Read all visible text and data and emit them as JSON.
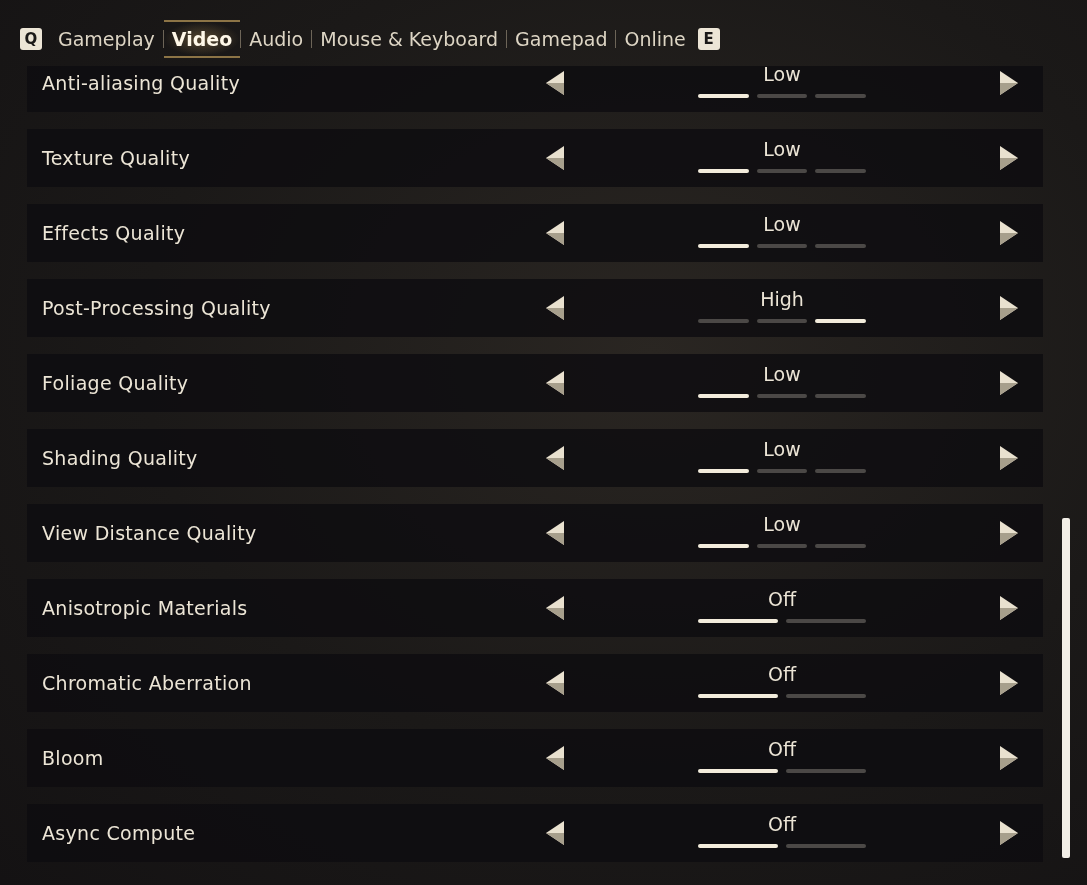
{
  "tabs": {
    "prev_key": "Q",
    "next_key": "E",
    "items": [
      {
        "label": "Gameplay",
        "selected": false
      },
      {
        "label": "Video",
        "selected": true
      },
      {
        "label": "Audio",
        "selected": false
      },
      {
        "label": "Mouse & Keyboard",
        "selected": false
      },
      {
        "label": "Gamepad",
        "selected": false
      },
      {
        "label": "Online",
        "selected": false
      }
    ]
  },
  "settings": [
    {
      "label": "Anti-aliasing Quality",
      "value": "Low",
      "segments": [
        {
          "selected": true
        },
        {
          "selected": false
        },
        {
          "selected": false
        }
      ]
    },
    {
      "label": "Texture Quality",
      "value": "Low",
      "segments": [
        {
          "selected": true
        },
        {
          "selected": false
        },
        {
          "selected": false
        }
      ]
    },
    {
      "label": "Effects Quality",
      "value": "Low",
      "segments": [
        {
          "selected": true
        },
        {
          "selected": false
        },
        {
          "selected": false
        }
      ]
    },
    {
      "label": "Post-Processing Quality",
      "value": "High",
      "segments": [
        {
          "selected": false
        },
        {
          "selected": false
        },
        {
          "selected": true
        }
      ]
    },
    {
      "label": "Foliage Quality",
      "value": "Low",
      "segments": [
        {
          "selected": true
        },
        {
          "selected": false
        },
        {
          "selected": false
        }
      ]
    },
    {
      "label": "Shading Quality",
      "value": "Low",
      "segments": [
        {
          "selected": true
        },
        {
          "selected": false
        },
        {
          "selected": false
        }
      ]
    },
    {
      "label": "View Distance Quality",
      "value": "Low",
      "segments": [
        {
          "selected": true
        },
        {
          "selected": false
        },
        {
          "selected": false
        }
      ]
    },
    {
      "label": "Anisotropic Materials",
      "value": "Off",
      "segments": [
        {
          "selected": true
        },
        {
          "selected": false
        }
      ]
    },
    {
      "label": "Chromatic Aberration",
      "value": "Off",
      "segments": [
        {
          "selected": true
        },
        {
          "selected": false
        }
      ]
    },
    {
      "label": "Bloom",
      "value": "Off",
      "segments": [
        {
          "selected": true
        },
        {
          "selected": false
        }
      ]
    },
    {
      "label": "Async Compute",
      "value": "Off",
      "segments": [
        {
          "selected": true
        },
        {
          "selected": false
        }
      ]
    }
  ]
}
